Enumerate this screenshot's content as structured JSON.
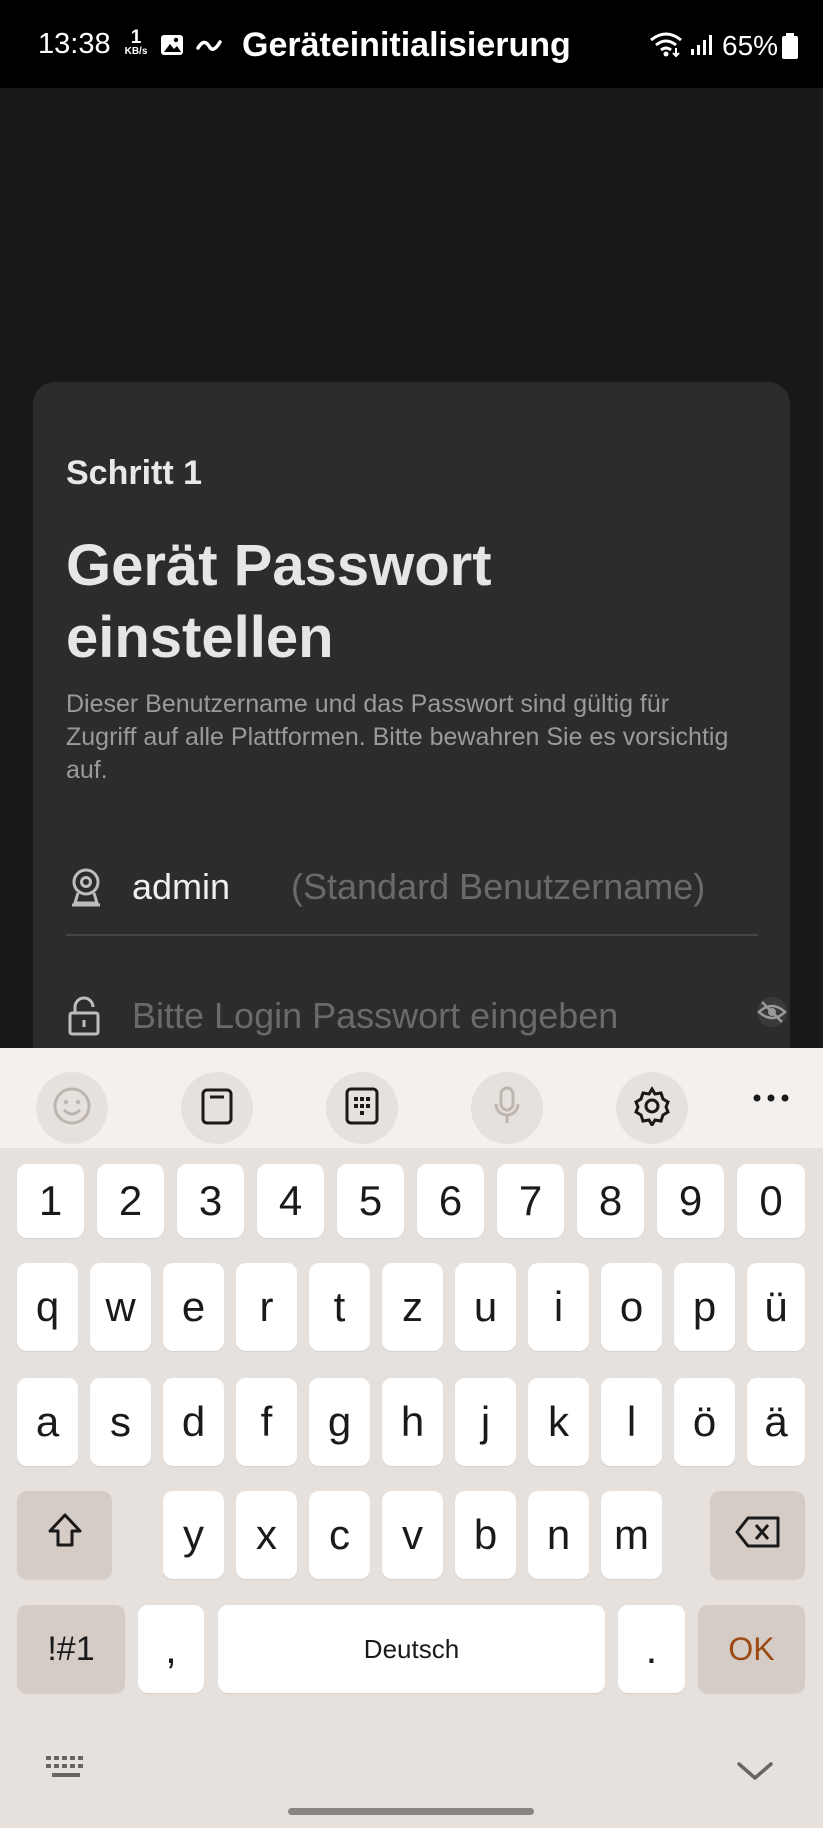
{
  "status_bar": {
    "time": "13:38",
    "net_speed": "1",
    "net_unit": "KB/s",
    "title": "Geräteinitialisierung",
    "battery": "65%"
  },
  "card": {
    "step": "Schritt 1",
    "title": "Gerät Passwort einstellen",
    "description": "Dieser Benutzername und das Passwort sind gültig für Zugriff auf alle Plattformen. Bitte bewahren Sie es vorsichtig auf.",
    "username": "admin",
    "username_hint": "(Standard Benutzername)",
    "password_placeholder": "Bitte Login Passwort eingeben"
  },
  "keyboard": {
    "numbers": [
      "1",
      "2",
      "3",
      "4",
      "5",
      "6",
      "7",
      "8",
      "9",
      "0"
    ],
    "row1": [
      "q",
      "w",
      "e",
      "r",
      "t",
      "z",
      "u",
      "i",
      "o",
      "p",
      "ü"
    ],
    "row2": [
      "a",
      "s",
      "d",
      "f",
      "g",
      "h",
      "j",
      "k",
      "l",
      "ö",
      "ä"
    ],
    "row3": [
      "y",
      "x",
      "c",
      "v",
      "b",
      "n",
      "m"
    ],
    "symbols": "!#1",
    "comma": ",",
    "space": "Deutsch",
    "period": ".",
    "ok": "OK"
  },
  "colors": {
    "card_bg": "#2c2c2c",
    "keyboard_bg": "#e6e1dd",
    "ok_text": "#9a4a12"
  }
}
